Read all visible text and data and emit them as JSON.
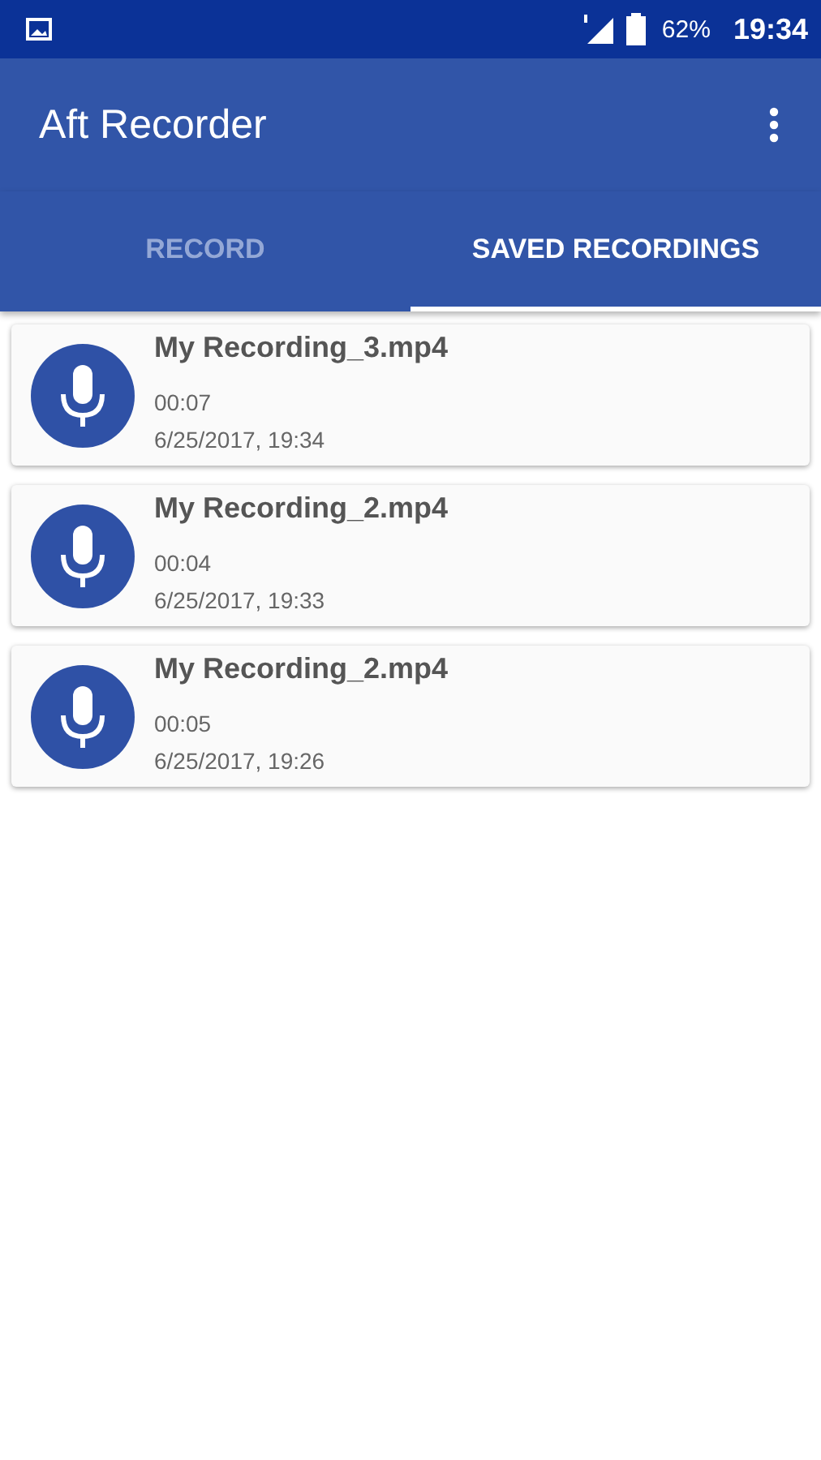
{
  "status_bar": {
    "battery": "62%",
    "time": "19:34"
  },
  "app_bar": {
    "title": "Aft Recorder"
  },
  "tabs": [
    {
      "label": "RECORD",
      "selected": false
    },
    {
      "label": "SAVED RECORDINGS",
      "selected": true
    }
  ],
  "recordings": [
    {
      "name": "My Recording_3.mp4",
      "duration": "00:07",
      "date": "6/25/2017, 19:34"
    },
    {
      "name": "My Recording_2.mp4",
      "duration": "00:04",
      "date": "6/25/2017, 19:33"
    },
    {
      "name": "My Recording_2.mp4",
      "duration": "00:05",
      "date": "6/25/2017, 19:26"
    }
  ]
}
